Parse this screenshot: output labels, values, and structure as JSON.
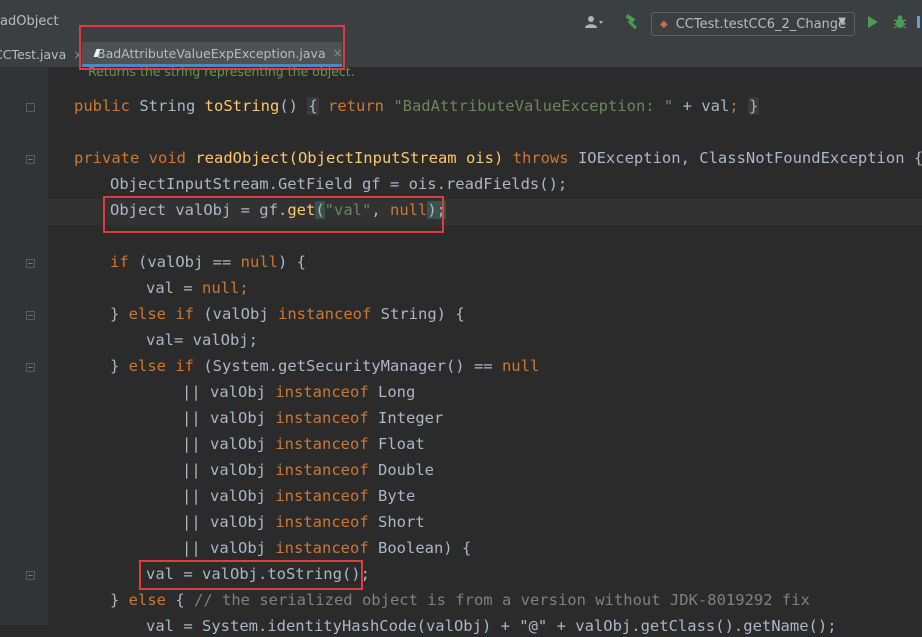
{
  "toolbar": {
    "breadcrumb": "adObject",
    "run_config": "CCTest.testCC6_2_Change",
    "icons": [
      "user-icon",
      "build-hammer-icon",
      "run-icon",
      "debug-icon"
    ]
  },
  "tabs": [
    {
      "label": "CCTest.java",
      "active": false
    },
    {
      "label": "BadAttributeValueExpException.java",
      "active": true
    }
  ],
  "editor": {
    "doc_hint": "Returns the string representing the object.",
    "lines": {
      "l1_kw": "public",
      "l1_a": " String ",
      "l1_m": "toString",
      "l1_b": "() ",
      "l1_brace1": "{",
      "l1_ret": " return ",
      "l1_str": "\"BadAttributeValueException: \"",
      "l1_c": " + val",
      "l1_semi": ";",
      "l1_brace2": "}",
      "l2_kw1": "private",
      "l2_kw2": " void ",
      "l2_a": "readObject(ObjectInputStream ois) ",
      "l2_throws": "throws",
      "l2_b": " IOException, ClassNotFoundException {",
      "l3": "ObjectInputStream.GetField gf = ois.readFields();",
      "l4_a": "Object valObj = gf.",
      "l4_m": "get",
      "l4_b": "(",
      "l4_str": "\"val\"",
      "l4_c": ", ",
      "l4_null": "null",
      "l4_d": ");",
      "l5_if": "if",
      "l5_a": " (valObj == ",
      "l5_null": "null",
      "l5_b": ") {",
      "l6_a": "val = ",
      "l6_null": "null",
      "l6_b": ";",
      "l7_a": "} ",
      "l7_else": "else if",
      "l7_b": " (valObj ",
      "l7_inst": "instanceof",
      "l7_c": " String) {",
      "l8": "val= valObj;",
      "l9_a": "} ",
      "l9_else": "else if",
      "l9_b": " (System.getSecurityManager() == ",
      "l9_null": "null",
      "or_prefix": "|| valObj ",
      "instanceof": "instanceof",
      "types": [
        " Long",
        " Integer",
        " Float",
        " Double",
        " Byte",
        " Short",
        " Boolean) {"
      ],
      "l17": "val = valObj.toString();",
      "l18_a": "} ",
      "l18_else": "else",
      "l18_b": " { ",
      "l18_cmt": "// the serialized object is from a version without JDK-8019292 fix",
      "l19": "val = System.identityHashCode(valObj) + \"@\" + valObj.getClass().getName();"
    }
  },
  "colors": {
    "keyword": "#cc7832",
    "string": "#6a8759",
    "comment": "#808080",
    "method": "#ffc66d",
    "highlight_box": "#e03c3c"
  }
}
